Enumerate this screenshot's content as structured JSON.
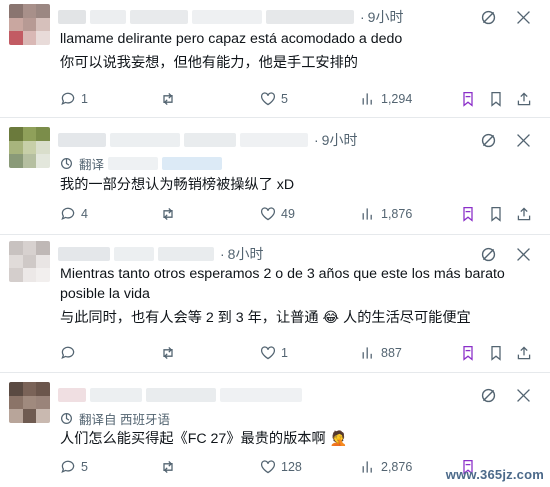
{
  "posts": [
    {
      "time": "9小时",
      "translated_label": "",
      "original": "llamame delirante pero capaz está acomodado a dedo",
      "translation": "你可以说我妄想，但他有能力，他是手工安排的",
      "replies": "1",
      "reposts": "",
      "likes": "5",
      "views": "1,294"
    },
    {
      "time": "9小时",
      "translated_label": "翻译",
      "original": "",
      "translation": "我的一部分想认为畅销榜被操纵了 xD",
      "replies": "4",
      "reposts": "",
      "likes": "49",
      "views": "1,876"
    },
    {
      "time": "8小时",
      "translated_label": "",
      "original": "Mientras tanto otros esperamos 2 o de 3 años que este los más barato posible la vida",
      "translation": "与此同时，也有人会等 2 到 3 年，让普通 😂 人的生活尽可能便宜",
      "replies": "",
      "reposts": "",
      "likes": "1",
      "views": "887"
    },
    {
      "time": "",
      "translated_label": "翻译自 西班牙语",
      "original": "",
      "translation": "人们怎么能买得起《FC 27》最贵的版本啊 🤦",
      "replies": "5",
      "reposts": "",
      "likes": "128",
      "views": "2,876"
    }
  ],
  "watermark": "www.365jz.com",
  "colors": {
    "bookmark_accent": "#8b2fc9",
    "muted": "#536471",
    "text": "#0f1419"
  }
}
